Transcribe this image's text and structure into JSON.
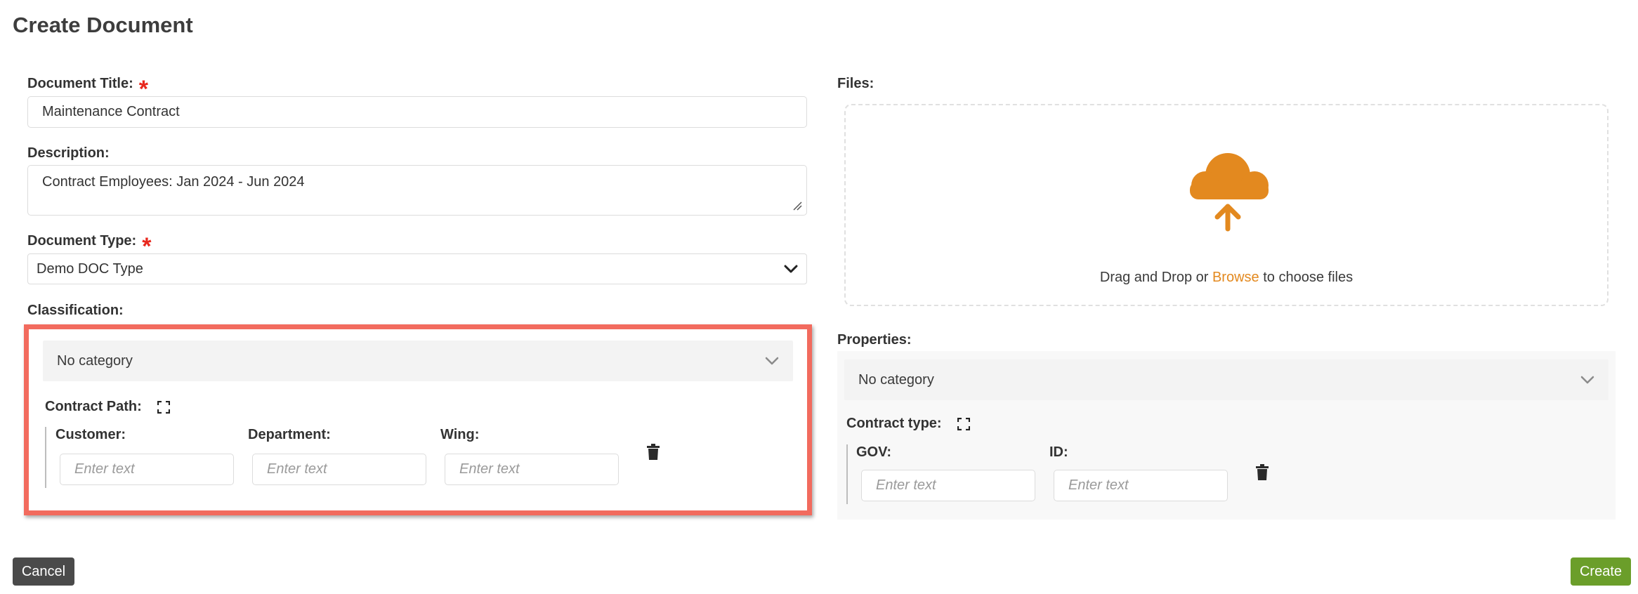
{
  "page": {
    "title": "Create Document"
  },
  "form": {
    "title_label": "Document Title:",
    "title_value": "Maintenance Contract",
    "description_label": "Description:",
    "description_value": "Contract Employees: Jan 2024 - Jun 2024",
    "doctype_label": "Document Type:",
    "doctype_value": "Demo DOC Type",
    "required_mark": "*",
    "classification_label": "Classification:"
  },
  "classification": {
    "category": "No category",
    "path_label": "Contract Path:",
    "fields": [
      {
        "label": "Customer:",
        "placeholder": "Enter text"
      },
      {
        "label": "Department:",
        "placeholder": "Enter text"
      },
      {
        "label": "Wing:",
        "placeholder": "Enter text"
      }
    ]
  },
  "files": {
    "label": "Files:",
    "drop_prefix": "Drag and Drop or ",
    "browse_label": "Browse",
    "drop_suffix": " to choose files"
  },
  "properties": {
    "label": "Properties:",
    "category": "No category",
    "type_label": "Contract type:",
    "fields": [
      {
        "label": "GOV:",
        "placeholder": "Enter text"
      },
      {
        "label": "ID:",
        "placeholder": "Enter text"
      }
    ]
  },
  "actions": {
    "cancel_label": "Cancel",
    "create_label": "Create"
  },
  "colors": {
    "accent": "#e3891f",
    "required": "#e8281e",
    "highlight_border": "#f26b5e",
    "create_button": "#6b9e2a",
    "cancel_button": "#4a4a4a"
  },
  "icons": [
    "chevron-down-icon",
    "expand-icon",
    "trash-icon",
    "cloud-upload-icon",
    "resize-handle-icon"
  ]
}
